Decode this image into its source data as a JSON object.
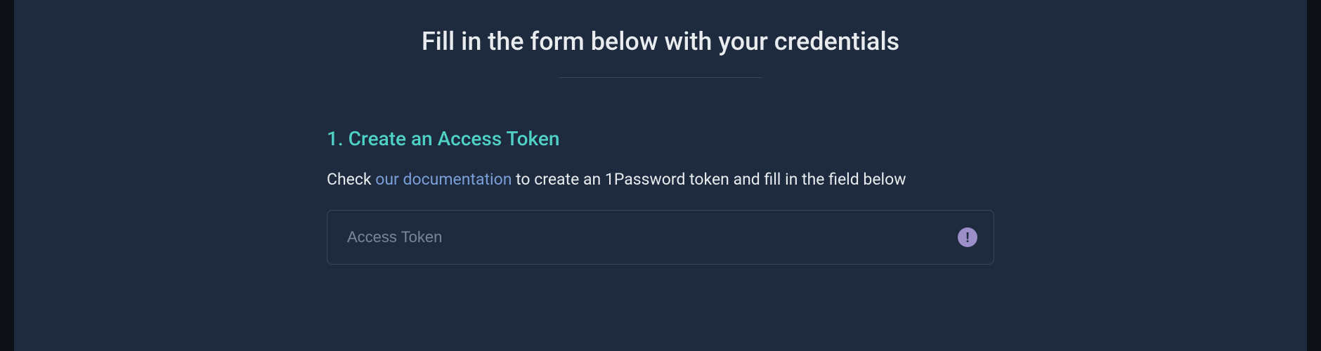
{
  "header": {
    "title": "Fill in the form below with your credentials"
  },
  "step1": {
    "title": "1. Create an Access Token",
    "description_prefix": "Check ",
    "link_text": "our documentation",
    "description_suffix": " to create an 1Password token and fill in the field below"
  },
  "input": {
    "placeholder": "Access Token",
    "value": ""
  }
}
